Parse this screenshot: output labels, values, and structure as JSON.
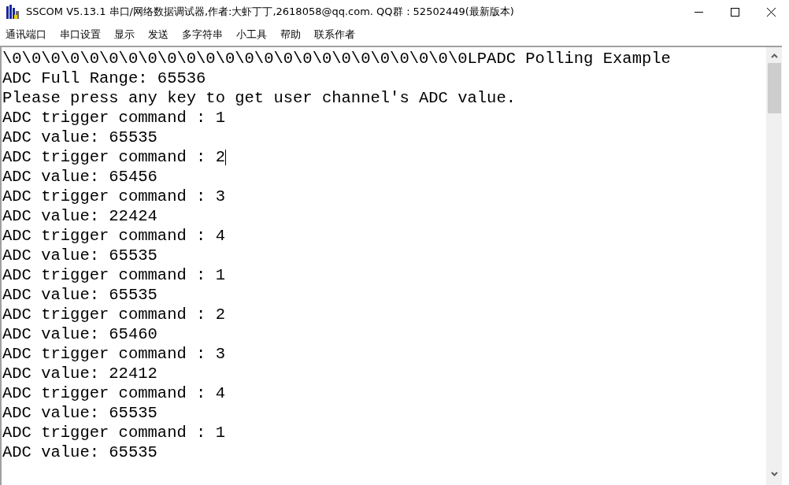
{
  "window": {
    "title": "SSCOM V5.13.1 串口/网络数据调试器,作者:大虾丁丁,2618058@qq.com. QQ群：52502449(最新版本)"
  },
  "menu": [
    "通讯端口",
    "串口设置",
    "显示",
    "发送",
    "多字符串",
    "小工具",
    "帮助",
    "联系作者"
  ],
  "terminal": {
    "lines": [
      {
        "text": "\\0\\0\\0\\0\\0\\0\\0\\0\\0\\0\\0\\0\\0\\0\\0\\0\\0\\0\\0\\0\\0\\0\\0\\0LPADC Polling Example",
        "caret": false
      },
      {
        "text": "ADC Full Range: 65536",
        "caret": false
      },
      {
        "text": "Please press any key to get user channel's ADC value.",
        "caret": false
      },
      {
        "text": "ADC trigger command : 1",
        "caret": false
      },
      {
        "text": "ADC value: 65535",
        "caret": false
      },
      {
        "text": "ADC trigger command : 2",
        "caret": true
      },
      {
        "text": "ADC value: 65456",
        "caret": false
      },
      {
        "text": "ADC trigger command : 3",
        "caret": false
      },
      {
        "text": "ADC value: 22424",
        "caret": false
      },
      {
        "text": "ADC trigger command : 4",
        "caret": false
      },
      {
        "text": "ADC value: 65535",
        "caret": false
      },
      {
        "text": "ADC trigger command : 1",
        "caret": false
      },
      {
        "text": "ADC value: 65535",
        "caret": false
      },
      {
        "text": "ADC trigger command : 2",
        "caret": false
      },
      {
        "text": "ADC value: 65460",
        "caret": false
      },
      {
        "text": "ADC trigger command : 3",
        "caret": false
      },
      {
        "text": "ADC value: 22412",
        "caret": false
      },
      {
        "text": "ADC trigger command : 4",
        "caret": false
      },
      {
        "text": "ADC value: 65535",
        "caret": false
      },
      {
        "text": "ADC trigger command : 1",
        "caret": false
      },
      {
        "text": "ADC value: 65535",
        "caret": false
      }
    ]
  }
}
